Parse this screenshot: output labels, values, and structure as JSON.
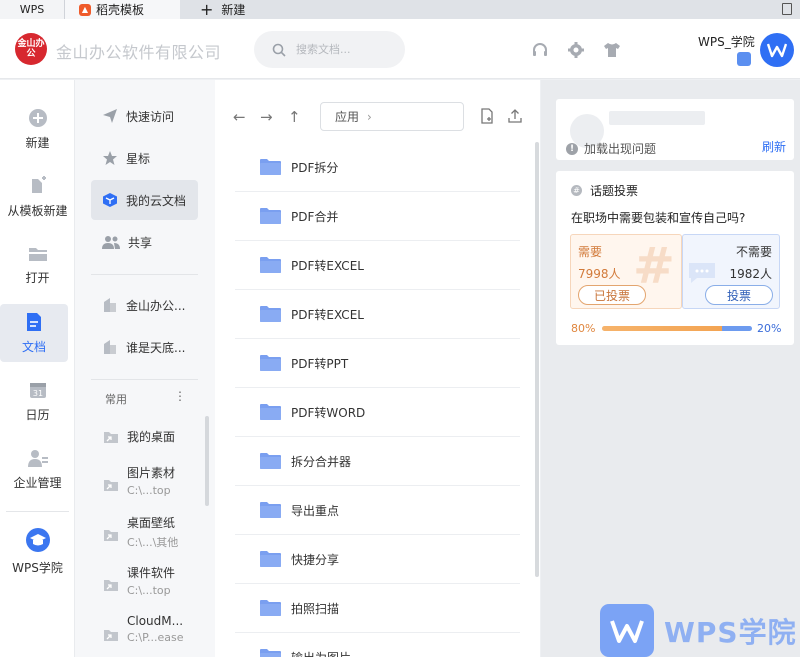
{
  "tabs": [
    {
      "label": "WPS"
    },
    {
      "label": "稻壳模板"
    },
    {
      "label": "新建"
    }
  ],
  "header": {
    "company": "金山办公软件有限公司",
    "logo_text": "金山办公",
    "search_placeholder": "搜索文档...",
    "user_name": "WPS_学院"
  },
  "rail": [
    {
      "label": "新建",
      "icon": "plus-circle-icon"
    },
    {
      "label": "从模板新建",
      "icon": "template-icon"
    },
    {
      "label": "打开",
      "icon": "folder-open-icon"
    },
    {
      "label": "文档",
      "icon": "document-icon",
      "active": true
    },
    {
      "label": "日历",
      "icon": "calendar-icon"
    },
    {
      "label": "企业管理",
      "icon": "enterprise-icon"
    },
    {
      "label": "WPS学院",
      "icon": "academy-icon"
    }
  ],
  "nav": {
    "items": [
      {
        "label": "快速访问",
        "icon": "send-icon"
      },
      {
        "label": "星标",
        "icon": "star-icon"
      },
      {
        "label": "我的云文档",
        "icon": "cloud-cube-icon",
        "active": true
      },
      {
        "label": "共享",
        "icon": "share-users-icon"
      }
    ],
    "groups": [
      {
        "label": "金山办公..."
      },
      {
        "label": "谁是天底..."
      }
    ],
    "section_label": "常用",
    "section_more": "⋮",
    "pinned": [
      {
        "title": "我的桌面",
        "path": ""
      },
      {
        "title": "图片素材",
        "path": "C:\\...top"
      },
      {
        "title": "桌面壁纸",
        "path": "C:\\...\\其他"
      },
      {
        "title": "课件软件",
        "path": "C:\\...top"
      },
      {
        "title": "CloudM...",
        "path": "C:\\P...ease"
      }
    ]
  },
  "main": {
    "path": "应用",
    "files": [
      {
        "name": "PDF拆分"
      },
      {
        "name": "PDF合并"
      },
      {
        "name": "PDF转EXCEL"
      },
      {
        "name": "PDF转EXCEL"
      },
      {
        "name": "PDF转PPT"
      },
      {
        "name": "PDF转WORD"
      },
      {
        "name": "拆分合并器"
      },
      {
        "name": "导出重点"
      },
      {
        "name": "快捷分享"
      },
      {
        "name": "拍照扫描"
      },
      {
        "name": "输出为图片"
      }
    ]
  },
  "right": {
    "load_error": "加载出现问题",
    "refresh": "刷新",
    "vote_title": "话题投票",
    "vote_question": "在职场中需要包装和宣传自己吗?",
    "yes_label": "需要",
    "yes_count": "7998人",
    "yes_button": "已投票",
    "no_label": "不需要",
    "no_count": "1982人",
    "no_button": "投票",
    "yes_pct": "80%",
    "no_pct": "20%",
    "yes_fraction": 0.8
  },
  "watermark": {
    "text": "WPS学院"
  },
  "colors": {
    "accent": "#2f6ff4",
    "brand_red": "#d7282f",
    "vote_orange": "#f3a453",
    "vote_blue": "#6d9bef"
  }
}
